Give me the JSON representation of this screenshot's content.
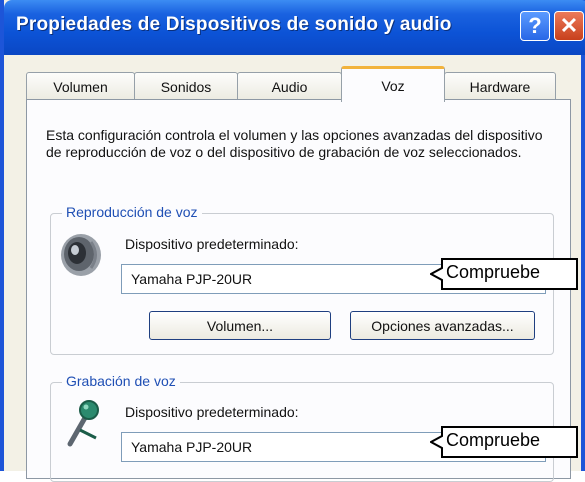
{
  "window": {
    "title": "Propiedades de Dispositivos de sonido y audio",
    "help_label": "?",
    "close_label": "✕"
  },
  "tabs": [
    {
      "label": "Volumen",
      "active": false
    },
    {
      "label": "Sonidos",
      "active": false
    },
    {
      "label": "Audio",
      "active": false
    },
    {
      "label": "Voz",
      "active": true
    },
    {
      "label": "Hardware",
      "active": false
    }
  ],
  "description": "Esta configuración controla el volumen y las opciones avanzadas del dispositivo de reproducción de voz o del dispositivo de grabación de voz seleccionados.",
  "playback": {
    "group_title": "Reproducción de voz",
    "device_label": "Dispositivo predeterminado:",
    "device_value": "Yamaha PJP-20UR",
    "volume_button": "Volumen...",
    "advanced_button": "Opciones avanzadas...",
    "icon": "speaker-icon"
  },
  "recording": {
    "group_title": "Grabación de voz",
    "device_label": "Dispositivo predeterminado:",
    "device_value": "Yamaha PJP-20UR",
    "icon": "microphone-icon"
  },
  "callouts": {
    "check_label": "Compruebe"
  }
}
